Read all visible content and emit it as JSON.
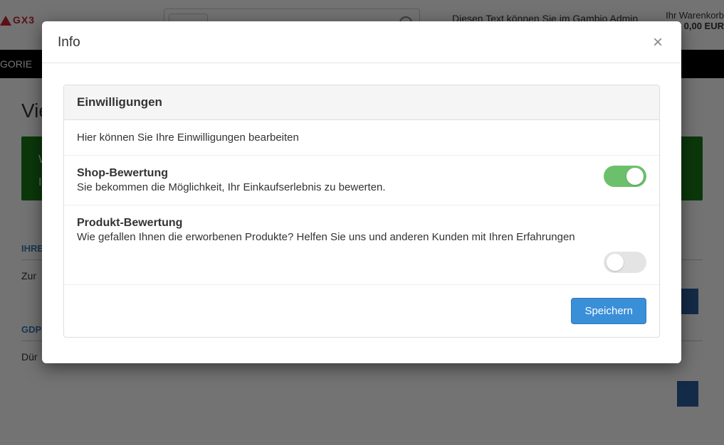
{
  "bg": {
    "logo_text": "GX3",
    "admin_text": "Diesen Text können Sie im Gambio Admin",
    "cart_label": "Ihr Warenkorb",
    "cart_value": "0,00 EUR",
    "nav_item": "GORIE",
    "heading": "Vie",
    "green_line1": "W",
    "green_line2": "I",
    "section1_label": "IHRE",
    "section1_text": "Zur",
    "section2_label": "GDPR",
    "section2_text": "Dür"
  },
  "modal": {
    "title": "Info",
    "panel_title": "Einwilligungen",
    "intro": "Hier können Sie Ihre Einwilligungen bearbeiten",
    "shop": {
      "title": "Shop-Bewertung",
      "desc": "Sie bekommen die Möglichkeit, Ihr Einkaufserlebnis zu bewerten.",
      "on": true
    },
    "product": {
      "title": "Produkt-Bewertung",
      "desc": "Wie gefallen Ihnen die erworbenen Produkte? Helfen Sie uns und anderen Kunden mit Ihren Erfahrungen",
      "on": false
    },
    "save_label": "Speichern"
  }
}
